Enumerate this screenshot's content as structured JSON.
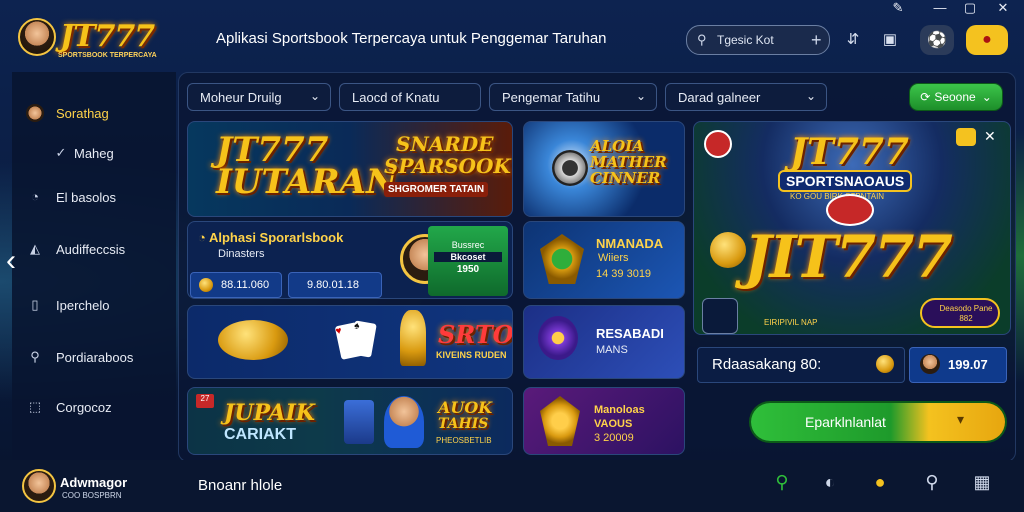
{
  "window": {
    "pin_icon": "pin-icon",
    "minimize": "—",
    "maximize": "▢",
    "close": "✕"
  },
  "header": {
    "brand": "JT777",
    "brand_sub": "SPORTSBOOK TERPERCAYA",
    "title": "Aplikasi Sportsbook Terpercaya untuk Penggemar Taruhan",
    "search_value": "Tgesic Kot",
    "search_plus": "+"
  },
  "sidebar": {
    "items": [
      {
        "label": "Sorathag",
        "icon": "avatar-icon",
        "active": true
      },
      {
        "label": "Maheg",
        "icon": "check-icon",
        "active": false
      },
      {
        "label": "El basolos",
        "icon": "pie-icon",
        "active": false
      },
      {
        "label": "Audiffeccsis",
        "icon": "shoe-icon",
        "active": false
      },
      {
        "label": "Iperchelo",
        "icon": "doc-icon",
        "active": false
      },
      {
        "label": "Pordiaraboos",
        "icon": "search-icon",
        "active": false
      },
      {
        "label": "Corgocoz",
        "icon": "chart-icon",
        "active": false
      }
    ]
  },
  "filters": [
    {
      "label": "Moheur Druilg"
    },
    {
      "label": "Laocd of Knatu"
    },
    {
      "label": "Pengemar Tatihu"
    },
    {
      "label": "Darad galneer"
    }
  ],
  "filter_button": "Seoone",
  "cards": {
    "banner_a": "JT777 IUTARAN",
    "banner_b_1": "SNARDE",
    "banner_b_2": "SPARSOOK",
    "banner_b_3": "SHGROMER TATAIN",
    "promo_title": "ALOIA MATHER CINNER",
    "promo_sub": "Alphasi Sporarlsbook",
    "promo_sub2": "Dinasters",
    "pill_1": "88.11.060",
    "pill_2": "9.80.01.18",
    "green_card_1": "Bussrec",
    "green_card_2": "Bkcoset",
    "green_card_3": "1950",
    "card_nmanada_1": "NMANADA",
    "card_nmanada_2": "Wiiers",
    "card_nmanada_3": "14 39 3019",
    "card_slot_1": "SRTO",
    "card_slot_2": "KIVEINS RUDEN",
    "card_resas_1": "RESABADI",
    "card_resas_2": "MANS",
    "card_jupaik_1": "JUPAIK",
    "card_jupaik_2": "CARIAKT",
    "card_auok_1": "AUOK",
    "card_auok_2": "TAHIS",
    "card_auok_3": "PHEOSBETLIB",
    "card_mano_1": "Manoloas",
    "card_mano_2": "VAOUS",
    "card_mano_3": "3 20009"
  },
  "hero": {
    "title_top": "JT777",
    "title_mid": "SPORTSNAOAUS",
    "title_mid_sub": "KO GOU BIRK STBNTAIN",
    "title_big": "JIT777",
    "small_text": "EIRIPIVIL NAP",
    "badge": "Deasodo Pane 882",
    "stat_label": "Rdaasakang 80:",
    "stat_value": "199.07",
    "cta": "Eparklnlanlat"
  },
  "bottom": {
    "name": "Adwmagor",
    "sub": "COO BOSPBRN",
    "title": "Bnoanr hlole"
  },
  "colors": {
    "accent_gold": "#f6c21a",
    "accent_green": "#2fbf3a",
    "bg_dark": "#0a1a3a"
  }
}
